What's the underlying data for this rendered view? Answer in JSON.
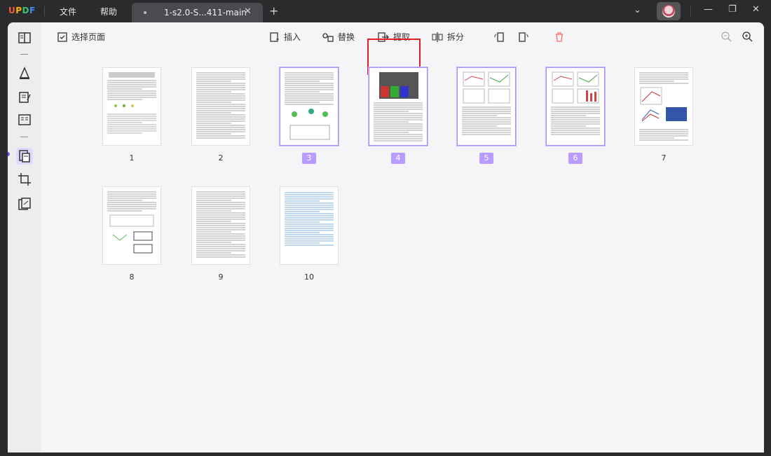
{
  "app": {
    "logo": "UPDF",
    "menu": [
      "文件",
      "帮助"
    ],
    "tab_title": "1-s2.0-S...411-main"
  },
  "toolbar": {
    "select_pages": "选择页面",
    "insert": "插入",
    "replace": "替换",
    "extract": "提取",
    "split": "拆分"
  },
  "pages": [
    {
      "label": "1",
      "selected": false
    },
    {
      "label": "2",
      "selected": false
    },
    {
      "label": "3",
      "selected": true
    },
    {
      "label": "4",
      "selected": true
    },
    {
      "label": "5",
      "selected": true
    },
    {
      "label": "6",
      "selected": true
    },
    {
      "label": "7",
      "selected": false
    },
    {
      "label": "8",
      "selected": false
    },
    {
      "label": "9",
      "selected": false
    },
    {
      "label": "10",
      "selected": false
    }
  ],
  "colors": {
    "accent": "#7a4dff",
    "selected_badge": "#b99cff",
    "highlight_box": "#e02020"
  }
}
